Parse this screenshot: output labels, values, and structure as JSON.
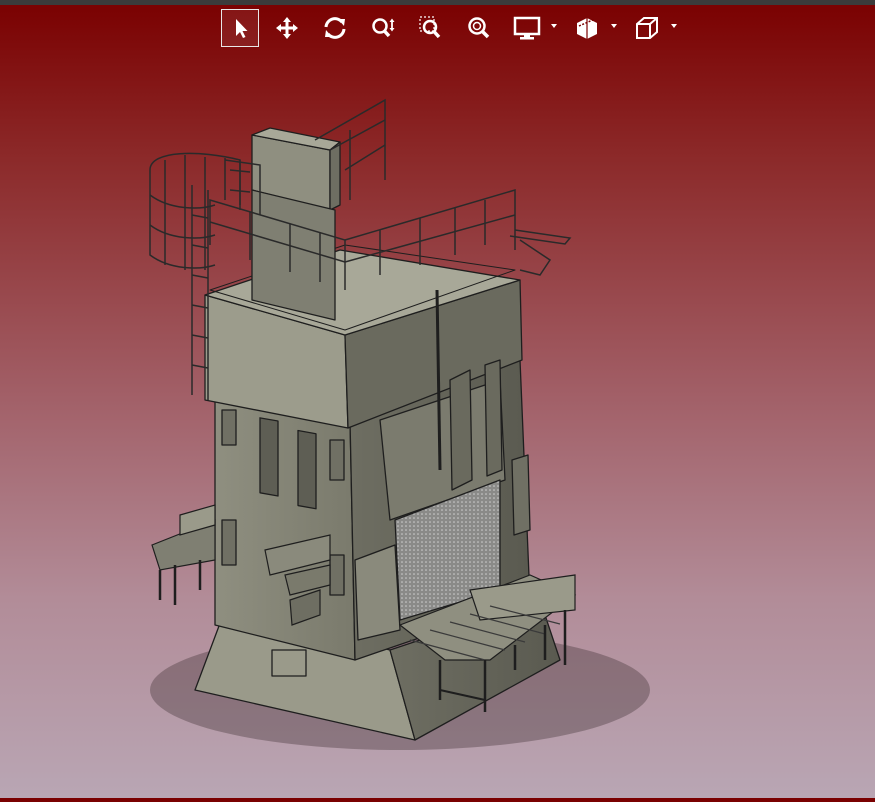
{
  "toolbar": {
    "tools": [
      {
        "name": "select-tool",
        "icon": "pointer-icon",
        "active": true
      },
      {
        "name": "pan-tool",
        "icon": "move-arrows-icon",
        "active": false
      },
      {
        "name": "rotate-tool",
        "icon": "rotate-icon",
        "active": false
      },
      {
        "name": "zoom-tool",
        "icon": "zoom-updown-icon",
        "active": false
      },
      {
        "name": "zoom-window-tool",
        "icon": "zoom-window-icon",
        "active": false
      },
      {
        "name": "zoom-fit-tool",
        "icon": "zoom-fit-icon",
        "active": false
      },
      {
        "name": "display-mode-menu",
        "icon": "monitor-icon",
        "has_dropdown": true
      },
      {
        "name": "section-menu",
        "icon": "section-cube-icon",
        "has_dropdown": true
      },
      {
        "name": "view-orientation-menu",
        "icon": "wireframe-cube-icon",
        "has_dropdown": true
      }
    ]
  },
  "colors": {
    "background_top": "#7a0000",
    "background_bottom": "#b9a6b4",
    "model_fill": "#8f8f80",
    "model_edge": "#1e1e1e",
    "toolbar_icon": "#ffffff"
  },
  "viewport": {
    "model": "hydraulic-press-assembly"
  }
}
